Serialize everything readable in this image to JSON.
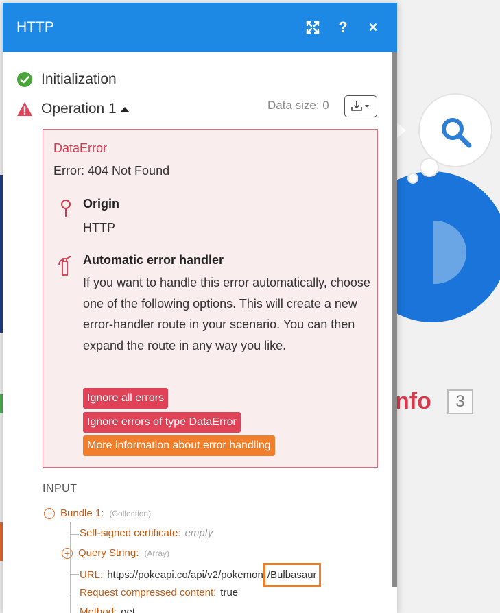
{
  "panel": {
    "title": "HTTP",
    "expand_icon": "expand-icon",
    "help_label": "?",
    "close_label": "×"
  },
  "status": {
    "initialization": "Initialization",
    "operation": "Operation 1",
    "data_size": "Data size: 0"
  },
  "error": {
    "title": "DataError",
    "message": "Error: 404 Not Found",
    "origin_title": "Origin",
    "origin_value": "HTTP",
    "handler_title": "Automatic error handler",
    "handler_text": "If you want to handle this error automatically, choose one of the following options. This will create a new error-handler route in your scenario. You can then expand the route in any way you like.",
    "buttons": [
      "Ignore all errors",
      "Ignore errors of type DataError",
      "More information about error handling"
    ]
  },
  "input": {
    "title": "INPUT",
    "bundle_label": "Bundle 1:",
    "bundle_type": "(Collection)",
    "self_signed_label": "Self-signed certificate:",
    "self_signed_value": "empty",
    "query_label": "Query String:",
    "query_type": "(Array)",
    "url_label": "URL:",
    "url_value": "https://pokeapi.co/api/v2/pokemon",
    "url_highlight": "/Bulbasaur",
    "compressed_label": "Request compressed content:",
    "compressed_value": "true",
    "method_label": "Method:",
    "method_value": "get"
  },
  "background": {
    "info_text": "nfo",
    "info_count": "3"
  },
  "colors": {
    "header": "#1e88e5",
    "error_red": "#d33a4c",
    "button_red": "#e04357",
    "button_orange": "#f07e2a",
    "success_green": "#4aa63b"
  }
}
